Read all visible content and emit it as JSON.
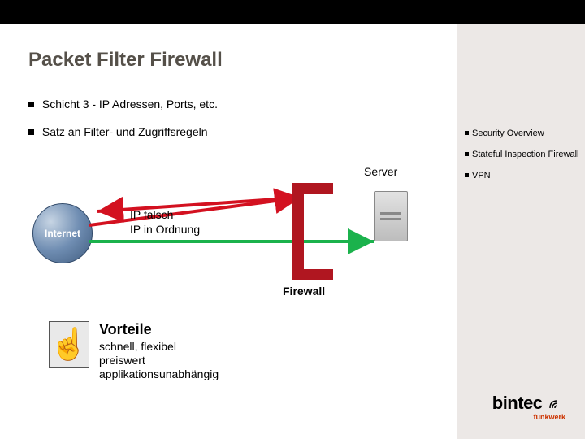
{
  "title": "Packet Filter Firewall",
  "bullets": [
    "Schicht 3 - IP Adressen, Ports, etc.",
    "Satz an Filter- und Zugriffsregeln"
  ],
  "side_nav": [
    "Security Overview",
    "Stateful Inspection Firewall",
    "VPN"
  ],
  "diagram": {
    "internet_label": "Internet",
    "firewall_label": "Firewall",
    "server_label": "Server",
    "arrow_red_label": "IP falsch",
    "arrow_green_label": "IP in Ordnung"
  },
  "vorteile": {
    "heading": "Vorteile",
    "lines": [
      "schnell, flexibel",
      "preiswert",
      "applikationsunabhängig"
    ]
  },
  "logo": {
    "brand": "bintec",
    "sub": "funkwerk"
  },
  "colors": {
    "firewall_red": "#b01620",
    "arrow_red": "#d31120",
    "arrow_green": "#1bb24c",
    "right_panel": "#ece8e6",
    "title_grey": "#555049"
  }
}
